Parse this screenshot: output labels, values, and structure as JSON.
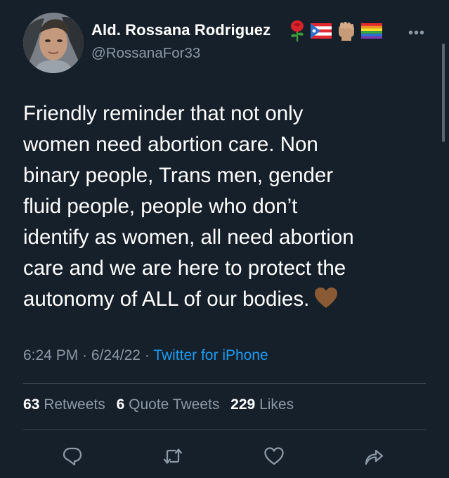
{
  "author": {
    "display_name": "Ald. Rossana Rodriguez",
    "handle": "@RossanaFor33",
    "name_emojis": [
      "rose-emoji",
      "puerto-rico-flag-emoji",
      "raised-fist-emoji",
      "rainbow-flag-emoji"
    ]
  },
  "tweet": {
    "text": "Friendly reminder that not only\nwomen need abortion care. Non\nbinary people, Trans men, gender\nfluid people, people who don’t\nidentify as women, all need abortion\ncare and we are here to protect the\nautonomy of ALL of our bodies.",
    "trailing_emoji": "brown-heart-emoji",
    "time": "6:24 PM",
    "separator": "·",
    "date": "6/24/22",
    "source": "Twitter for iPhone"
  },
  "stats": {
    "retweets_count": "63",
    "retweets_label": "Retweets",
    "quotes_count": "6",
    "quotes_label": "Quote Tweets",
    "likes_count": "229",
    "likes_label": "Likes"
  },
  "actions": [
    "reply-icon",
    "retweet-icon",
    "like-icon",
    "share-icon"
  ],
  "colors": {
    "background": "#15202b",
    "text": "#ffffff",
    "secondary": "#8b98a5",
    "link": "#1d9bf0",
    "divider": "#38444d"
  }
}
